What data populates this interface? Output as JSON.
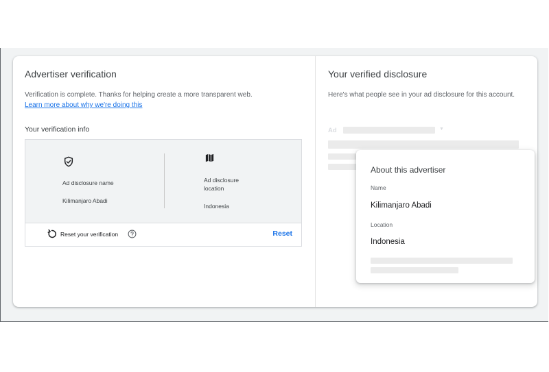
{
  "left": {
    "title": "Advertiser verification",
    "description": "Verification is complete. Thanks for helping create a more transparent web.",
    "learn_more_link": "Learn more about why we're doing this",
    "section_label": "Your verification info",
    "info": {
      "name_icon": "shield-check-icon",
      "name_label": "Ad disclosure name",
      "name_value": "Kilimanjaro Abadi",
      "location_icon": "map-icon",
      "location_label_line1": "Ad disclosure",
      "location_label_line2": "location",
      "location_value": "Indonesia"
    },
    "reset": {
      "icon": "reset-icon",
      "text": "Reset your verification",
      "help_icon": "help-circle-icon",
      "button_label": "Reset"
    }
  },
  "right": {
    "title": "Your verified disclosure",
    "description": "Here's what people see in your ad disclosure for this account.",
    "ad_label": "Ad",
    "popup": {
      "title": "About this advertiser",
      "name_label": "Name",
      "name_value": "Kilimanjaro Abadi",
      "location_label": "Location",
      "location_value": "Indonesia"
    }
  },
  "colors": {
    "link": "#1a73e8",
    "background": "#f1f3f4",
    "placeholder": "#ebebeb"
  }
}
